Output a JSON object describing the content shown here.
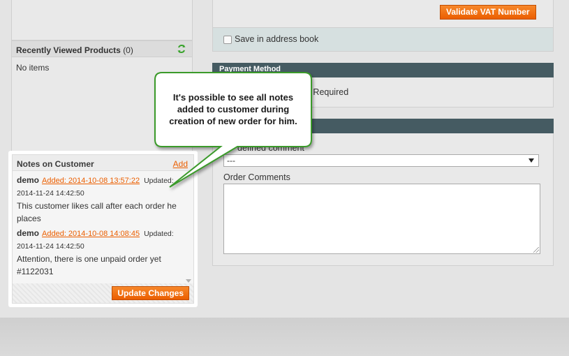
{
  "toolbar": {
    "validate_vat_label": "Validate VAT Number"
  },
  "address": {
    "save_in_book_label": "Save in address book"
  },
  "recently_viewed": {
    "title": "Recently Viewed Products",
    "count": "(0)",
    "empty_text": "No items"
  },
  "notes_panel": {
    "title": "Notes on Customer",
    "add_link": "Add",
    "notes": [
      {
        "user": "demo",
        "added": "Added: 2014-10-08 13:57:22",
        "updated_label": "Updated:",
        "updated_date": "2014-11-24 14:42:50",
        "text": "This customer likes call after each order he places"
      },
      {
        "user": "demo",
        "added": "Added: 2014-10-08 14:08:45",
        "updated_label": "Updated:",
        "updated_date": "2014-11-24 14:42:50",
        "text": "Attention, there is one unpaid order yet #1122031"
      }
    ],
    "update_button": "Update Changes"
  },
  "payment": {
    "title": "Payment Method",
    "partial_text": "n Required"
  },
  "order_comments": {
    "predefined_label": "defined comment",
    "select_value": "---",
    "comments_label": "Order Comments"
  },
  "callout": {
    "text": "It's possible to see all notes added to customer during creation of new order for him."
  },
  "colors": {
    "accent_orange": "#eb5e00",
    "section_header": "#455b62",
    "callout_border": "#3a9a2a"
  }
}
